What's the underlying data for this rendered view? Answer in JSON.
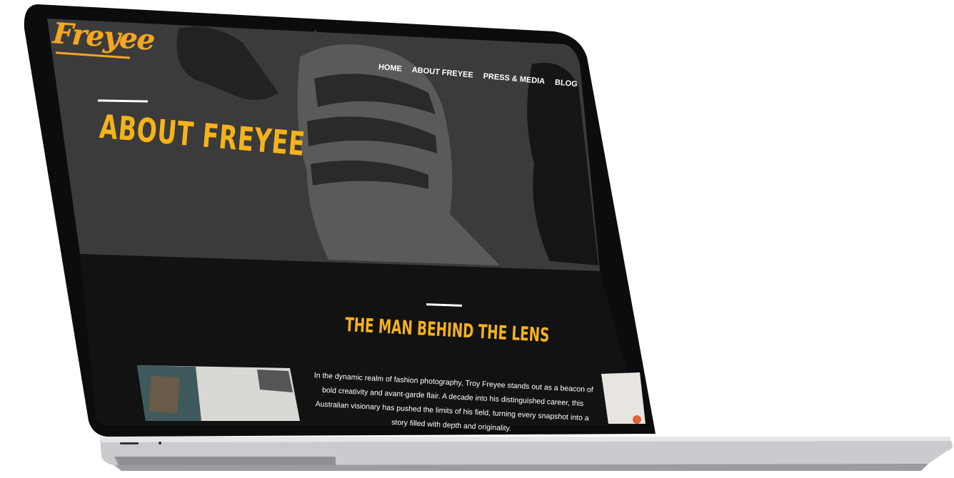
{
  "site": {
    "logo": "Freyee"
  },
  "nav": {
    "items": [
      "HOME",
      "ABOUT FREYEE",
      "PRESS & MEDIA",
      "BLOG"
    ]
  },
  "hero": {
    "title": "ABOUT FREYEE"
  },
  "section": {
    "title": "THE MAN BEHIND THE LENS",
    "body": "In the dynamic realm of fashion photography, Troy Freyee stands out as a beacon of bold creativity and avant-garde flair. A decade into his distinguished career, this Australian visionary has pushed the limits of his field, turning every snapshot into a story filled with depth and originality."
  },
  "colors": {
    "accent": "#f5b21a",
    "background": "#111111",
    "hero_bg": "#3a3a3a",
    "text": "#ffffff"
  }
}
